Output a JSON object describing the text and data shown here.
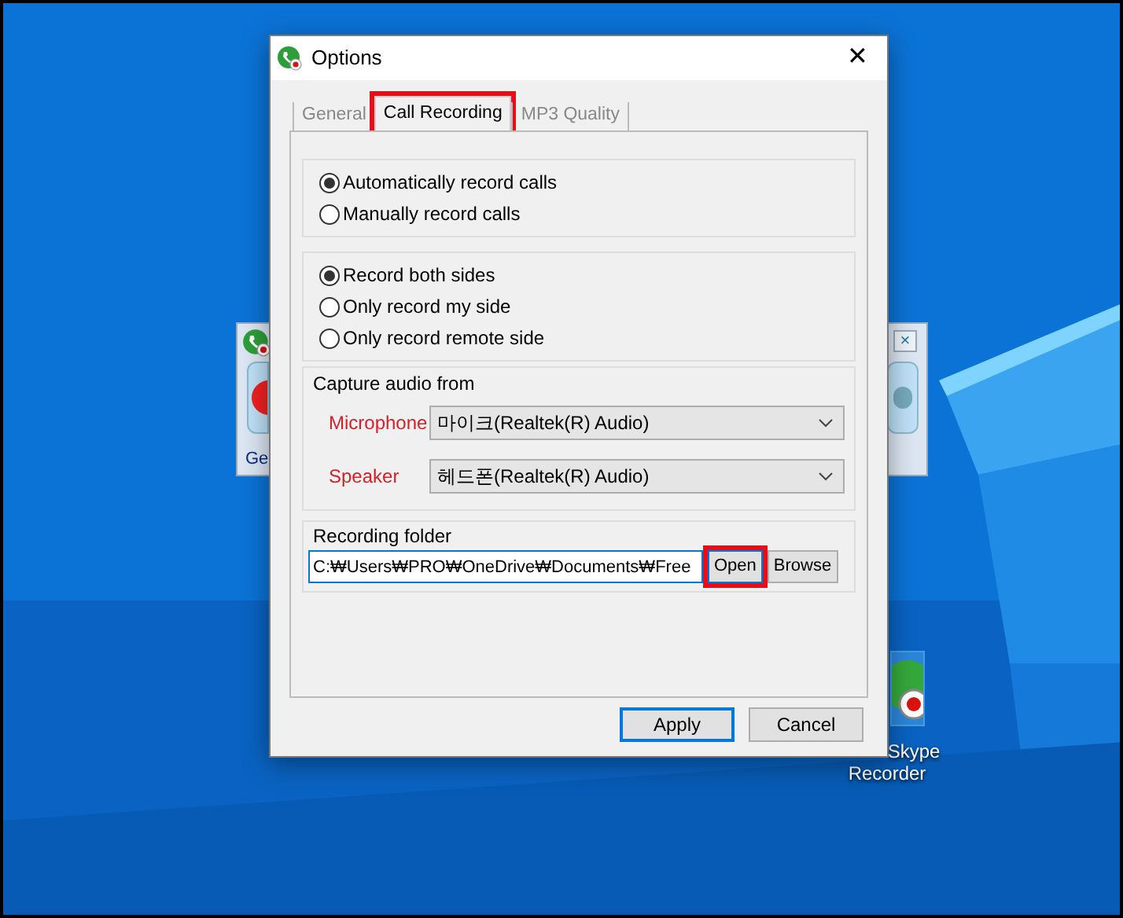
{
  "background_window": {
    "label": "Ge",
    "close_button": "×"
  },
  "desktop_icon": {
    "label_lines": [
      "Skype",
      "Recorder"
    ]
  },
  "window": {
    "title": "Options",
    "close_button": "✕"
  },
  "tabs": [
    {
      "label": "General",
      "selected": false,
      "highlighted": false
    },
    {
      "label": "Call Recording",
      "selected": true,
      "highlighted": true
    },
    {
      "label": "MP3 Quality",
      "selected": false,
      "highlighted": false
    }
  ],
  "record_mode": [
    {
      "label": "Automatically record calls",
      "selected": true
    },
    {
      "label": "Manually record calls",
      "selected": false
    }
  ],
  "record_sides": [
    {
      "label": "Record both sides",
      "selected": true
    },
    {
      "label": "Only record my side",
      "selected": false
    },
    {
      "label": "Only record remote side",
      "selected": false
    }
  ],
  "capture_audio": {
    "title": "Capture audio from",
    "devices": [
      {
        "label": "Microphone",
        "value": "마이크(Realtek(R) Audio)"
      },
      {
        "label": "Speaker",
        "value": "헤드폰(Realtek(R) Audio)"
      }
    ]
  },
  "recording_folder": {
    "title": "Recording folder",
    "path": "C:₩Users₩PRO₩OneDrive₩Documents₩Free",
    "buttons": [
      {
        "label": "Open",
        "highlighted": true
      },
      {
        "label": "Browse",
        "highlighted": false
      }
    ]
  },
  "footer_buttons": [
    {
      "label": "Apply",
      "default": true
    },
    {
      "label": "Cancel",
      "default": false
    }
  ]
}
